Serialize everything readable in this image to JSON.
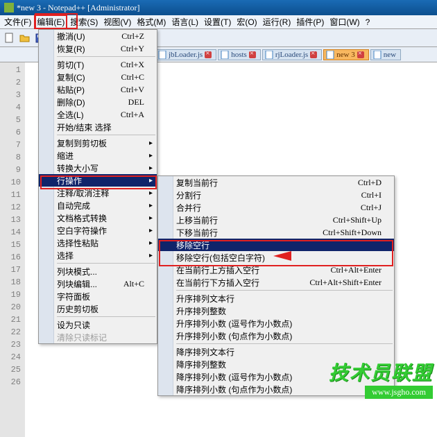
{
  "title": "*new 3 - Notepad++ [Administrator]",
  "menubar": [
    "文件(F)",
    "编辑(E)",
    "搜索(S)",
    "视图(V)",
    "格式(M)",
    "语言(L)",
    "设置(T)",
    "宏(O)",
    "运行(R)",
    "插件(P)",
    "窗口(W)",
    "?"
  ],
  "tabs": [
    {
      "label": "jbLoader.js",
      "active": false,
      "close": true
    },
    {
      "label": "hosts",
      "active": false,
      "close": true
    },
    {
      "label": "rjLoader.js",
      "active": false,
      "close": true
    },
    {
      "label": "new 3",
      "active": true,
      "close": true
    },
    {
      "label": "new",
      "active": false,
      "close": false
    }
  ],
  "line_count": 26,
  "edit_menu": [
    {
      "t": "item",
      "label": "撤消(U)",
      "shortcut": "Ctrl+Z"
    },
    {
      "t": "item",
      "label": "恢复(R)",
      "shortcut": "Ctrl+Y"
    },
    {
      "t": "sep"
    },
    {
      "t": "item",
      "label": "剪切(T)",
      "shortcut": "Ctrl+X"
    },
    {
      "t": "item",
      "label": "复制(C)",
      "shortcut": "Ctrl+C"
    },
    {
      "t": "item",
      "label": "粘贴(P)",
      "shortcut": "Ctrl+V"
    },
    {
      "t": "item",
      "label": "删除(D)",
      "shortcut": "DEL"
    },
    {
      "t": "item",
      "label": "全选(L)",
      "shortcut": "Ctrl+A"
    },
    {
      "t": "item",
      "label": "开始/结束 选择",
      "shortcut": ""
    },
    {
      "t": "sep"
    },
    {
      "t": "item",
      "label": "复制到剪切板",
      "sub": true
    },
    {
      "t": "item",
      "label": "缩进",
      "sub": true
    },
    {
      "t": "item",
      "label": "转换大小写",
      "sub": true
    },
    {
      "t": "item",
      "label": "行操作",
      "sub": true,
      "hl": true
    },
    {
      "t": "item",
      "label": "注释/取消注释",
      "sub": true
    },
    {
      "t": "item",
      "label": "自动完成",
      "sub": true
    },
    {
      "t": "item",
      "label": "文档格式转换",
      "sub": true
    },
    {
      "t": "item",
      "label": "空白字符操作",
      "sub": true
    },
    {
      "t": "item",
      "label": "选择性粘贴",
      "sub": true
    },
    {
      "t": "item",
      "label": "选择",
      "sub": true
    },
    {
      "t": "sep"
    },
    {
      "t": "item",
      "label": "列块模式...",
      "shortcut": ""
    },
    {
      "t": "item",
      "label": "列块编辑...",
      "shortcut": "Alt+C"
    },
    {
      "t": "item",
      "label": "字符面板",
      "shortcut": ""
    },
    {
      "t": "item",
      "label": "历史剪切板",
      "shortcut": ""
    },
    {
      "t": "sep"
    },
    {
      "t": "item",
      "label": "设为只读",
      "shortcut": ""
    },
    {
      "t": "item",
      "label": "清除只读标记",
      "shortcut": "",
      "dis": true
    }
  ],
  "line_menu": [
    {
      "t": "item",
      "label": "复制当前行",
      "shortcut": "Ctrl+D"
    },
    {
      "t": "item",
      "label": "分割行",
      "shortcut": "Ctrl+I"
    },
    {
      "t": "item",
      "label": "合并行",
      "shortcut": "Ctrl+J"
    },
    {
      "t": "item",
      "label": "上移当前行",
      "shortcut": "Ctrl+Shift+Up"
    },
    {
      "t": "item",
      "label": "下移当前行",
      "shortcut": "Ctrl+Shift+Down"
    },
    {
      "t": "item",
      "label": "移除空行",
      "shortcut": "",
      "hl": true
    },
    {
      "t": "item",
      "label": "移除空行(包括空白字符)",
      "shortcut": ""
    },
    {
      "t": "item",
      "label": "在当前行上方插入空行",
      "shortcut": "Ctrl+Alt+Enter"
    },
    {
      "t": "item",
      "label": "在当前行下方插入空行",
      "shortcut": "Ctrl+Alt+Shift+Enter"
    },
    {
      "t": "sep"
    },
    {
      "t": "item",
      "label": "升序排列文本行",
      "shortcut": ""
    },
    {
      "t": "item",
      "label": "升序排列整数",
      "shortcut": ""
    },
    {
      "t": "item",
      "label": "升序排列小数 (逗号作为小数点)",
      "shortcut": ""
    },
    {
      "t": "item",
      "label": "升序排列小数 (句点作为小数点)",
      "shortcut": ""
    },
    {
      "t": "sep"
    },
    {
      "t": "item",
      "label": "降序排列文本行",
      "shortcut": ""
    },
    {
      "t": "item",
      "label": "降序排列整数",
      "shortcut": ""
    },
    {
      "t": "item",
      "label": "降序排列小数 (逗号作为小数点)",
      "shortcut": ""
    },
    {
      "t": "item",
      "label": "降序排列小数 (句点作为小数点)",
      "shortcut": ""
    }
  ],
  "watermark": {
    "text": "技术员联盟",
    "url": "www.jsgho.com"
  }
}
